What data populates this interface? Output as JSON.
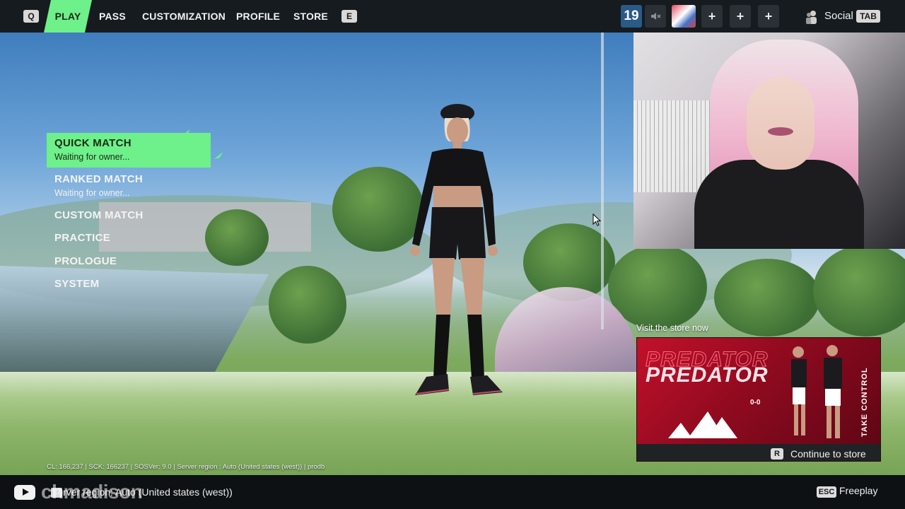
{
  "topbar": {
    "left_key": "Q",
    "tabs": [
      "PLAY",
      "PASS",
      "CUSTOMIZATION",
      "PROFILE",
      "STORE"
    ],
    "active_tab": "PLAY",
    "right_key": "E",
    "level": "19",
    "mute_icon": "speaker-muted-icon",
    "plus_labels": [
      "+",
      "+",
      "+"
    ],
    "social_label": "Social",
    "social_key": "TAB"
  },
  "menu": {
    "items": [
      {
        "title": "QUICK MATCH",
        "subtitle": "Waiting for owner..."
      },
      {
        "title": "RANKED MATCH",
        "subtitle": "Waiting for owner..."
      },
      {
        "title": "CUSTOM MATCH"
      },
      {
        "title": "PRACTICE"
      },
      {
        "title": "PROLOGUE"
      },
      {
        "title": "SYSTEM"
      }
    ],
    "selected_index": 0
  },
  "store_promo": {
    "heading": "Visit the store now",
    "brand_title": "PREDATOR",
    "tagline": "TAKE CONTROL",
    "score": "0-0",
    "continue_key": "R",
    "continue_label": "Continue to store"
  },
  "status_line": "CL: 166,237 | SCK: 166237 | SOSVer: 9.0 | Server region : Auto (United states (west)) | prodb",
  "bottombar": {
    "watermark": "chmadison",
    "region_text": "Server region: Auto (United states (west))",
    "esc_key": "ESC",
    "freeplay_label": "Freeplay"
  },
  "colors": {
    "accent_green": "#6ef08a",
    "topbar_bg": "#161b1f",
    "level_badge": "#2a5a86",
    "promo_red": "#c3112b"
  }
}
